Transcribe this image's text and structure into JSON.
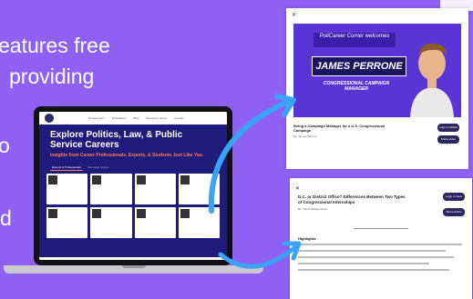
{
  "hero": {
    "line1": "eatures free",
    "line2": "providing",
    "line3": "o",
    "line4": "d"
  },
  "laptop": {
    "nav_items": [
      "Development",
      "Professions",
      "Blog",
      "Resource Library",
      "Contact"
    ],
    "headline": "Explore Politics, Law, & Public Service Careers",
    "subhead": "Insights from Career Professionals, Experts, & Students Just Like You.",
    "tabs": [
      "Experts & Professionals",
      "Internship Stories"
    ]
  },
  "panel1": {
    "close_glyph": "✕",
    "banner": "PoliCareer Corner welcomes",
    "name": "JAMES PERRONE",
    "role": "CONGRESSIONAL CAMPAIGN MANAGER",
    "caption": "Being a Campaign Manager for a U.S. Congressional Campaign",
    "author": "By: James Perrone",
    "button1": "Login to Watch Video",
    "button2": "Share Video"
  },
  "panel2": {
    "close_glyph": "✕",
    "title": "D.C. or District Office? Differences Between Two Types of Congressional Internships",
    "author": "By: The Pathways Team",
    "button1": "Login to Save Article",
    "button2": "Share Article",
    "heading": "Highlights"
  },
  "colors": {
    "background": "#8e60f3",
    "laptop_hero": "#1f1b7a",
    "accent": "#ff7a59",
    "arrow": "#3aa3f5"
  }
}
